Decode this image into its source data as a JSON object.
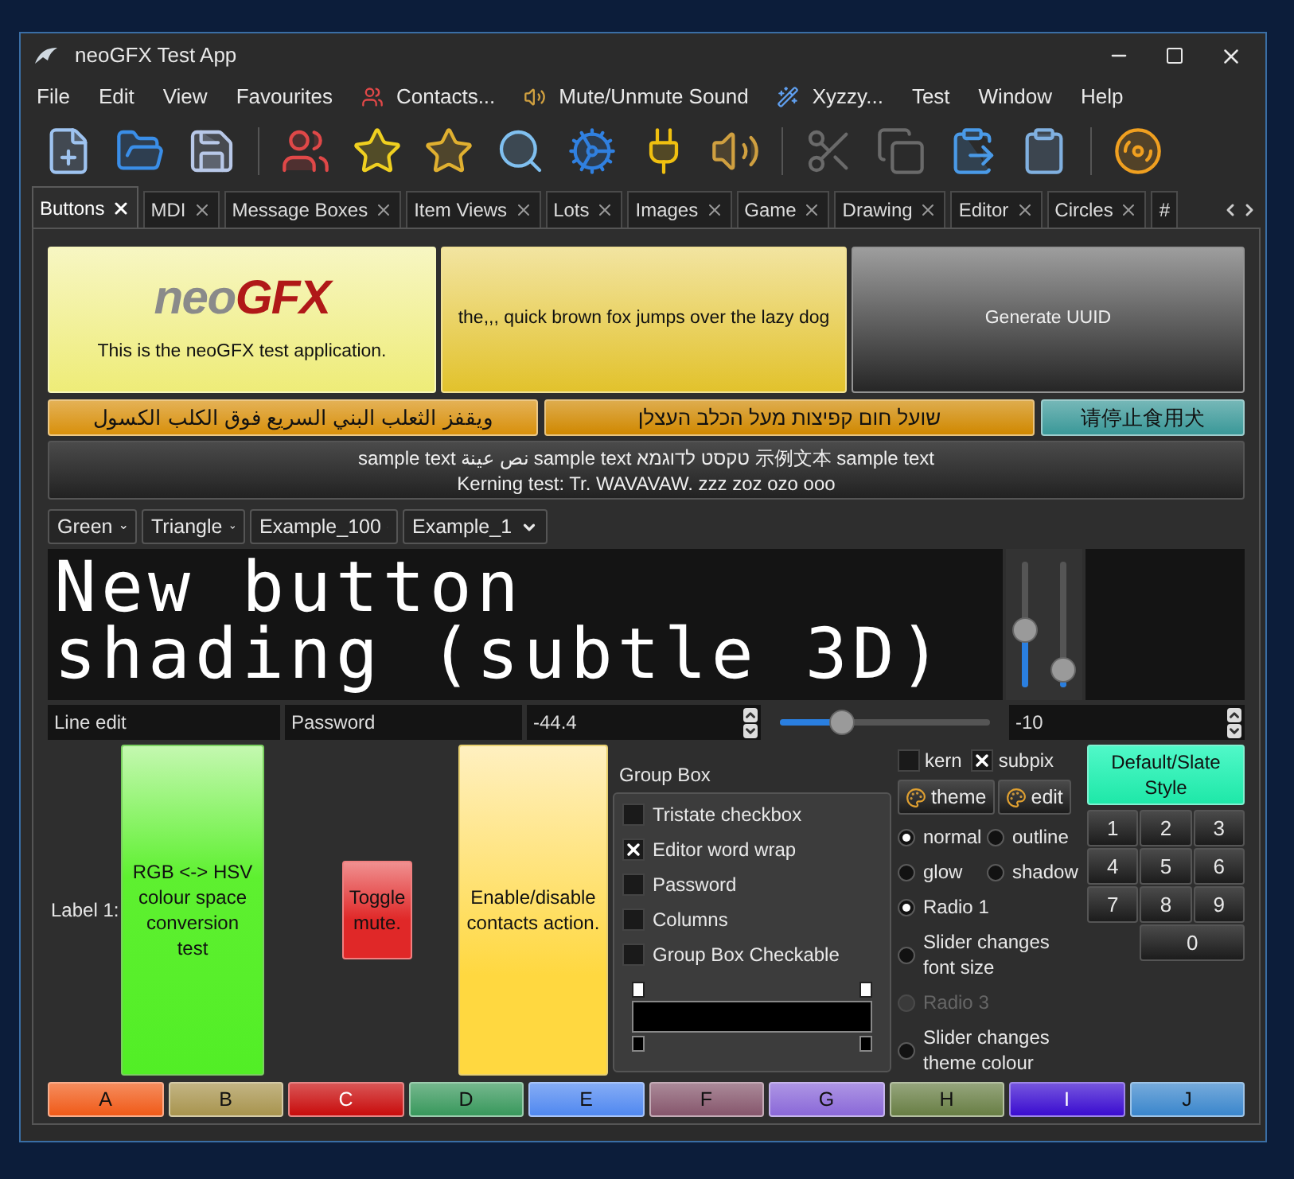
{
  "window": {
    "title": "neoGFX Test App"
  },
  "menu": [
    {
      "label": "File",
      "kind": "text"
    },
    {
      "label": "Edit",
      "kind": "text"
    },
    {
      "label": "View",
      "kind": "text"
    },
    {
      "label": "Favourites",
      "kind": "text"
    },
    {
      "label": "Contacts...",
      "kind": "contacts"
    },
    {
      "label": "Mute/Unmute Sound",
      "kind": "sound"
    },
    {
      "label": "Xyzzy...",
      "kind": "wand"
    },
    {
      "label": "Test",
      "kind": "text"
    },
    {
      "label": "Window",
      "kind": "text"
    },
    {
      "label": "Help",
      "kind": "text"
    }
  ],
  "toolbar": [
    {
      "kind": "new",
      "disabled": false
    },
    {
      "kind": "open",
      "disabled": false
    },
    {
      "kind": "save",
      "disabled": false
    },
    {
      "kind": "separator"
    },
    {
      "kind": "contacts",
      "disabled": false
    },
    {
      "kind": "add_favourite",
      "disabled": false
    },
    {
      "kind": "favourites",
      "disabled": false
    },
    {
      "kind": "search",
      "disabled": false
    },
    {
      "kind": "settings",
      "disabled": false
    },
    {
      "kind": "plug",
      "disabled": false
    },
    {
      "kind": "sound",
      "disabled": false
    },
    {
      "kind": "separator"
    },
    {
      "kind": "cut",
      "disabled": true
    },
    {
      "kind": "copy",
      "disabled": true
    },
    {
      "kind": "paste",
      "disabled": false
    },
    {
      "kind": "clipboard",
      "disabled": false
    },
    {
      "kind": "separator"
    },
    {
      "kind": "media",
      "disabled": false
    }
  ],
  "tabs": [
    {
      "label": "Buttons",
      "selected": true,
      "closable": true
    },
    {
      "label": "MDI",
      "selected": false,
      "closable": true
    },
    {
      "label": "Message Boxes",
      "selected": false,
      "closable": true
    },
    {
      "label": "Item Views",
      "selected": false,
      "closable": true
    },
    {
      "label": "Lots",
      "selected": false,
      "closable": true
    },
    {
      "label": "Images",
      "selected": false,
      "closable": true
    },
    {
      "label": "Game",
      "selected": false,
      "closable": true
    },
    {
      "label": "Drawing",
      "selected": false,
      "closable": true
    },
    {
      "label": "Editor",
      "selected": false,
      "closable": true
    },
    {
      "label": "Circles",
      "selected": false,
      "closable": true
    },
    {
      "label": "#",
      "selected": false,
      "closable": false
    }
  ],
  "hero_buttons": [
    {
      "logo": [
        "neo",
        "GFX"
      ],
      "label": "This is the neoGFX test application.",
      "color": "#eeec78"
    },
    {
      "label": "the,,, quick brown fox jumps over the lazy dog",
      "color": "#e2c22c"
    },
    {
      "label": "Generate UUID",
      "color": "#262626"
    }
  ],
  "arabic_button": {
    "label": "ويقفز الثعلب البني السريع فوق الكلب الكسول",
    "color": "#d8900c"
  },
  "hebrew_button": {
    "label": "שועל חום קפיצות מעל הכלב העצלן",
    "color": "#d08800"
  },
  "chinese_button": {
    "label": "请停止食用犬",
    "color": "#3a9898"
  },
  "sample_button": {
    "lines": [
      "sample text نص عينة sample text טקסט לדוגמא 示例文本 sample text",
      "Kerning test: Tr. WAVAVAW. zzz zoz ozo ooo"
    ]
  },
  "dropdowns": [
    {
      "value": "Green"
    },
    {
      "value": "Triangle"
    },
    {
      "value": "Example_100"
    },
    {
      "value": "Example_1"
    }
  ],
  "display_text": [
    "New button",
    "shading (subtle 3D)"
  ],
  "vertical_sliders": [
    {
      "level": 0.45
    },
    {
      "level": 0.05
    }
  ],
  "fields": {
    "line_edit": {
      "value": "Line edit"
    },
    "password": {
      "value": "Password"
    },
    "spin_1": {
      "value": "-44.4"
    },
    "slider": {
      "level": 0.27
    },
    "spin_2": {
      "value": "-10"
    }
  },
  "label_1": "Label 1:",
  "rgb_button": "RGB <-> HSV colour space conversion test",
  "mute_button": "Toggle mute.",
  "contacts_button": "Enable/disable contacts action.",
  "group_box": {
    "title": "Group Box",
    "checkboxes": [
      {
        "label": "Tristate checkbox",
        "checked": false
      },
      {
        "label": "Editor word wrap",
        "checked": true
      },
      {
        "label": "Password",
        "checked": false
      },
      {
        "label": "Columns",
        "checked": false
      },
      {
        "label": "Group Box Checkable",
        "checked": false
      }
    ]
  },
  "render_options": [
    {
      "label": "kern",
      "checked": false
    },
    {
      "label": "subpix",
      "checked": true
    }
  ],
  "theme_buttons": [
    "theme",
    "edit"
  ],
  "text_effects": [
    {
      "label": "normal",
      "selected": true
    },
    {
      "label": "outline",
      "selected": false
    },
    {
      "label": "glow",
      "selected": false
    },
    {
      "label": "shadow",
      "selected": false
    }
  ],
  "radios": [
    {
      "label": "Radio 1",
      "selected": true,
      "disabled": false
    },
    {
      "label": "Slider changes font size",
      "selected": false,
      "disabled": false
    },
    {
      "label": "Radio 3",
      "selected": false,
      "disabled": true
    },
    {
      "label": "Slider changes theme colour",
      "selected": false,
      "disabled": false
    }
  ],
  "style_button": "Default/Slate Style",
  "keypad": [
    "1",
    "2",
    "3",
    "4",
    "5",
    "6",
    "7",
    "8",
    "9",
    "0"
  ],
  "color_buttons": [
    {
      "label": "A",
      "color": "#f05a18"
    },
    {
      "label": "B",
      "color": "#a8944e"
    },
    {
      "label": "C",
      "color": "#c80c0c"
    },
    {
      "label": "D",
      "color": "#38985c"
    },
    {
      "label": "E",
      "color": "#5088f0"
    },
    {
      "label": "F",
      "color": "#86566c"
    },
    {
      "label": "G",
      "color": "#8a68d8"
    },
    {
      "label": "H",
      "color": "#687e44"
    },
    {
      "label": "I",
      "color": "#3a0cd0"
    },
    {
      "label": "J",
      "color": "#3a86cc"
    }
  ]
}
